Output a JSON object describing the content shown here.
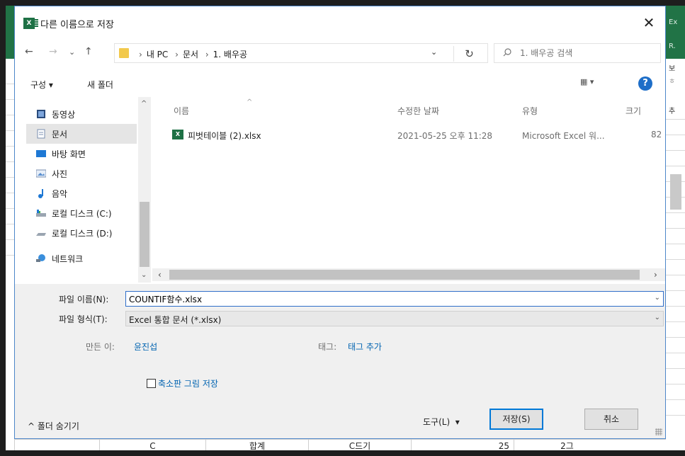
{
  "dialog": {
    "title": "다른 이름으로 저장",
    "close_glyph": "✕"
  },
  "address": {
    "back": "←",
    "forward": "→",
    "recent": "⌄",
    "up": "↑",
    "crumbs": [
      "내 PC",
      "문서",
      "1. 배우공"
    ],
    "dropdown": "⌄",
    "refresh": "↻",
    "search_placeholder": "1. 배우공 검색"
  },
  "toolbar": {
    "organize": "구성 ▾",
    "new_folder": "새 폴더",
    "view": "▦ ▾",
    "help": "?"
  },
  "navpane": {
    "items": [
      {
        "label": "동영상",
        "icon": "video-icon"
      },
      {
        "label": "문서",
        "icon": "document-icon",
        "selected": true
      },
      {
        "label": "바탕 화면",
        "icon": "desktop-icon"
      },
      {
        "label": "사진",
        "icon": "pictures-icon"
      },
      {
        "label": "음악",
        "icon": "music-icon"
      },
      {
        "label": "로컬 디스크 (C:)",
        "icon": "drive-icon"
      },
      {
        "label": "로컬 디스크 (D:)",
        "icon": "drive-icon"
      },
      {
        "label": "네트워크",
        "icon": "network-icon"
      }
    ]
  },
  "files": {
    "columns": {
      "name": "이름",
      "modified": "수정한 날짜",
      "type": "유형",
      "size": "크기"
    },
    "rows": [
      {
        "name": "피벗테이블 (2).xlsx",
        "modified": "2021-05-25 오후 11:28",
        "type": "Microsoft Excel 워...",
        "size": "82"
      }
    ]
  },
  "form": {
    "filename_label": "파일 이름(N):",
    "filename_value": "COUNTIF함수.xlsx",
    "filetype_label": "파일 형식(T):",
    "filetype_value": "Excel 통합 문서 (*.xlsx)",
    "author_label": "만든 이:",
    "author_value": "윤진섭",
    "tags_label": "태그:",
    "tags_value": "태그 추가",
    "thumbnail_label": "축소판 그림 저장"
  },
  "footer": {
    "hide_folders": "^ 폴더 숨기기",
    "tools": "도구(L)",
    "save": "저장(S)",
    "cancel": "취소"
  },
  "background": {
    "right_top": [
      "Ex",
      "R.",
      "보",
      "ㅎ"
    ],
    "right_side": "추",
    "bottom_cells": [
      "C",
      "합계",
      "C드기",
      "25",
      "2그"
    ]
  }
}
